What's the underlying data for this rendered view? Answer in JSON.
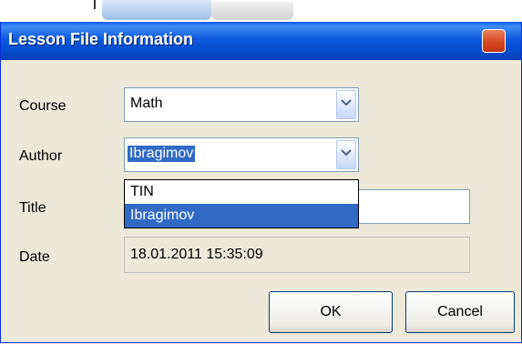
{
  "dialog": {
    "title": "Lesson File Information"
  },
  "form": {
    "course": {
      "label": "Course",
      "value": "Math"
    },
    "author": {
      "label": "Author",
      "value": "Ibragimov",
      "options": [
        "TIN",
        "Ibragimov"
      ]
    },
    "title": {
      "label": "Title",
      "value": ""
    },
    "date": {
      "label": "Date",
      "value": "18.01.2011 15:35:09"
    }
  },
  "buttons": {
    "ok": "OK",
    "cancel": "Cancel"
  },
  "colors": {
    "title_bar": "#0a5ae8",
    "selection": "#316ac5",
    "dialog_bg": "#ece9d8"
  },
  "icons": {
    "close": "close-icon",
    "dropdown": "chevron-down-icon"
  }
}
